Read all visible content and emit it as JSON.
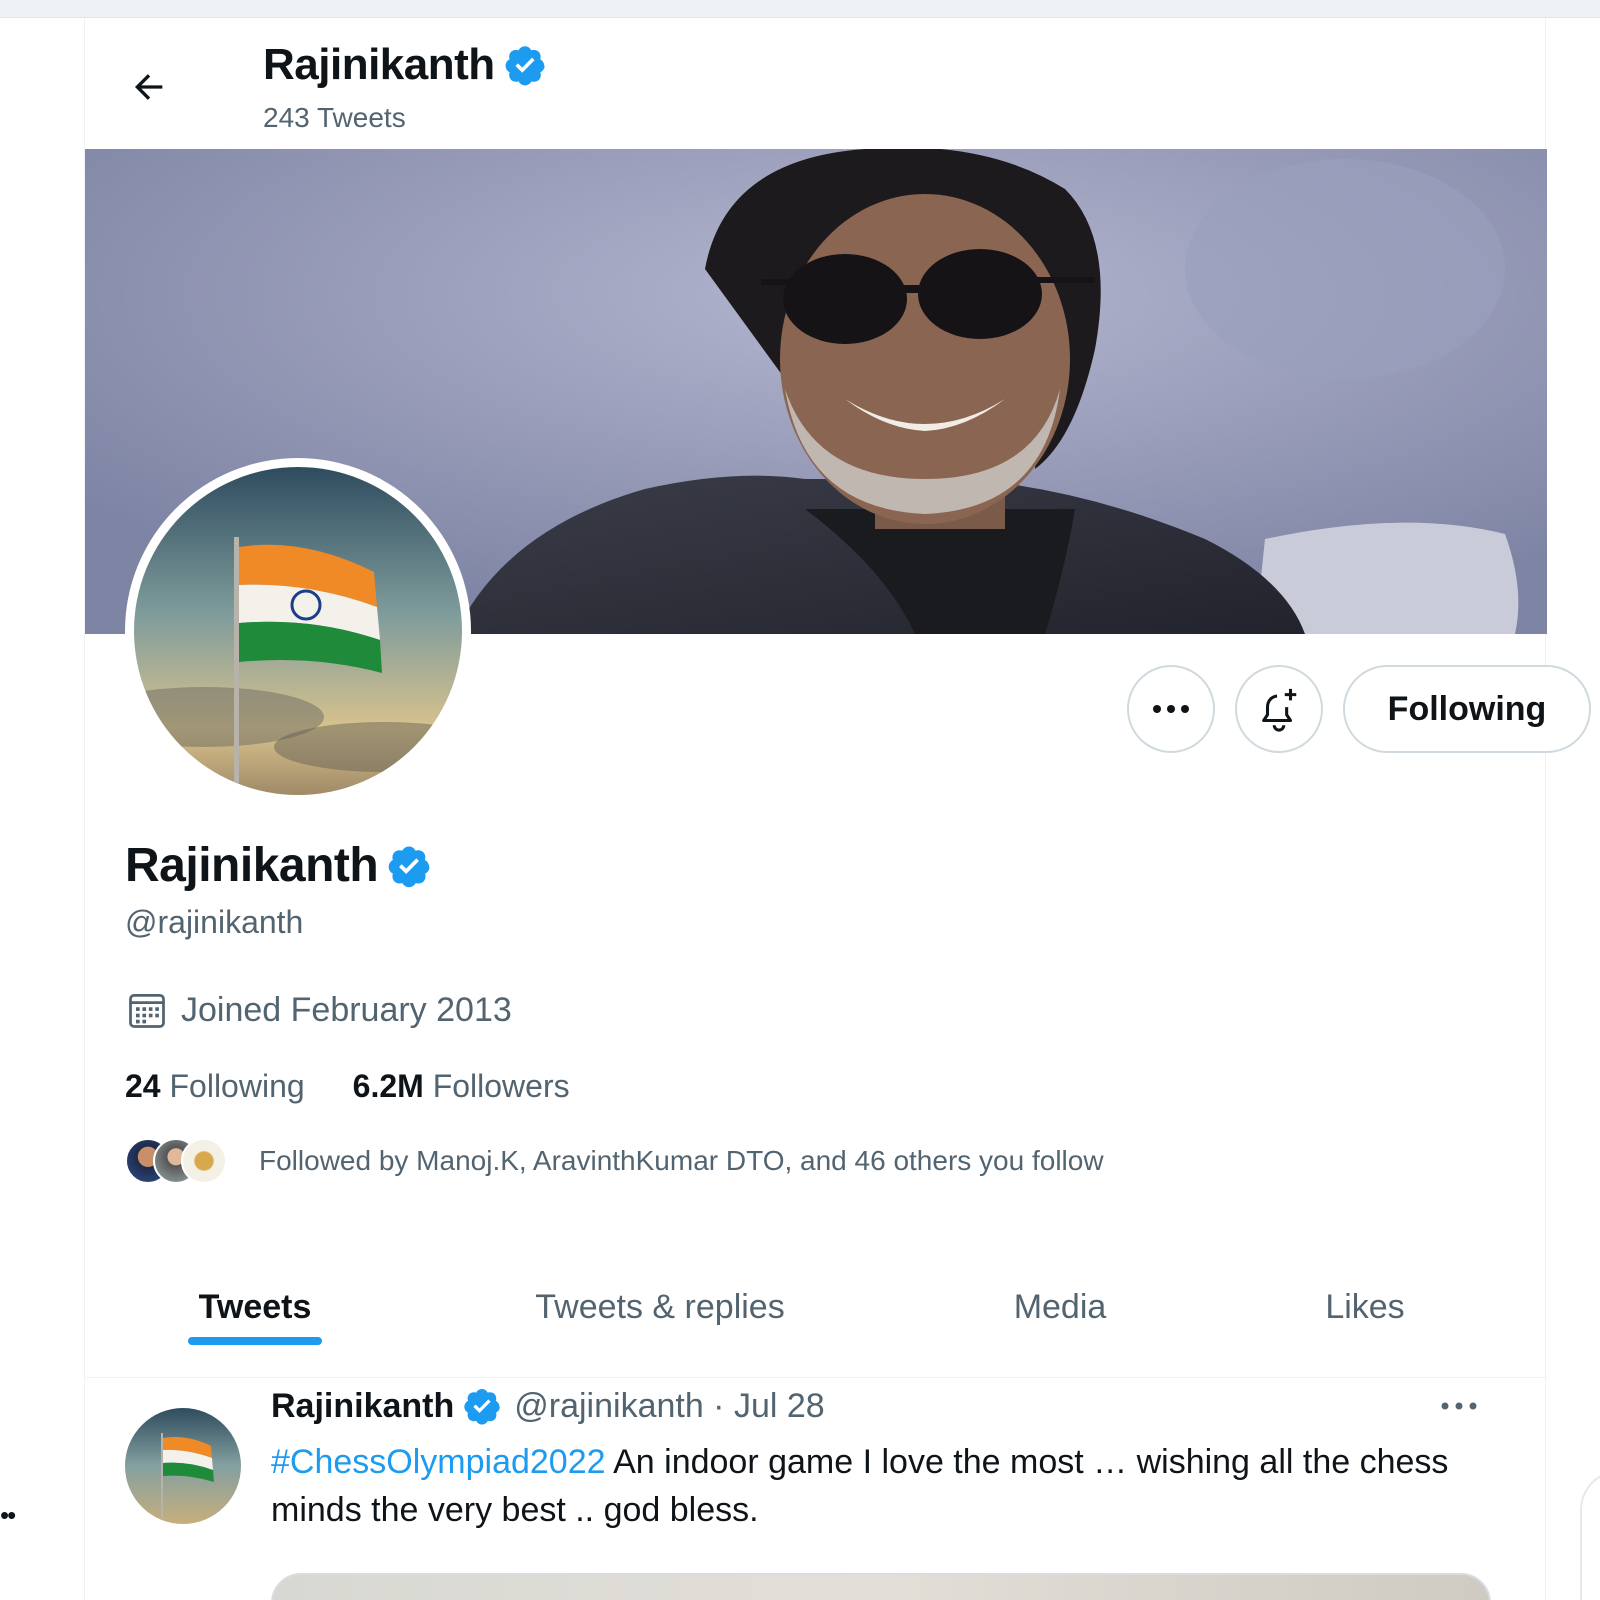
{
  "header": {
    "name": "Rajinikanth",
    "tweet_count": "243 Tweets"
  },
  "profile": {
    "name": "Rajinikanth",
    "handle": "@rajinikanth",
    "joined": "Joined February 2013",
    "following_count": "24",
    "following_label": "Following",
    "followers_count": "6.2M",
    "followers_label": "Followers",
    "followed_by": "Followed by Manoj.K, AravinthKumar DTO, and 46 others you follow"
  },
  "actions": {
    "following_button": "Following"
  },
  "tabs": [
    {
      "label": "Tweets",
      "active": true
    },
    {
      "label": "Tweets & replies",
      "active": false
    },
    {
      "label": "Media",
      "active": false
    },
    {
      "label": "Likes",
      "active": false
    }
  ],
  "tweet": {
    "name": "Rajinikanth",
    "handle": "@rajinikanth · Jul 28",
    "hashtag": "#ChessOlympiad2022",
    "text": " An indoor game I love the most … wishing all the chess minds the very best .. god bless."
  },
  "colors": {
    "accent": "#1d9bf0",
    "secondary_text": "#536471",
    "primary_text": "#0f1419"
  },
  "icons": {
    "back": "arrow-left-icon",
    "verified": "verified-badge-icon",
    "more": "more-horizontal-icon",
    "notify": "bell-plus-icon",
    "calendar": "calendar-icon"
  }
}
